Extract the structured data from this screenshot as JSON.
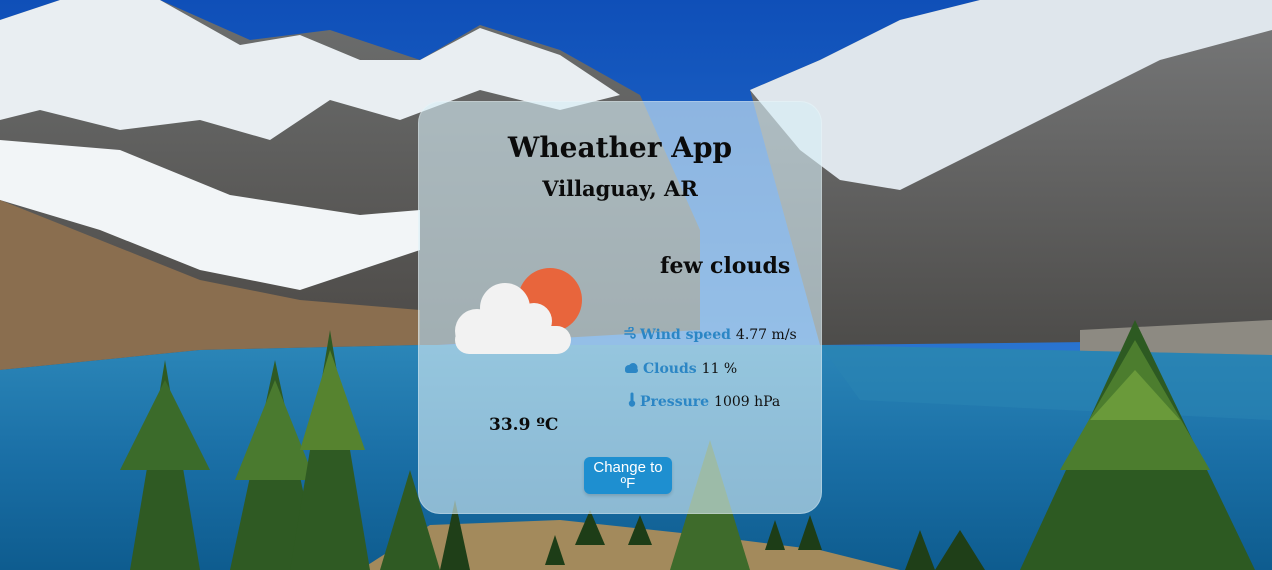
{
  "app": {
    "title": "Wheather App",
    "location": "Villaguay, AR"
  },
  "weather": {
    "description": "few clouds",
    "icon": "few-clouds-icon",
    "temperature": "33.9 ºC"
  },
  "stats": {
    "wind": {
      "icon": "wind-icon",
      "label": "Wind speed",
      "value": "4.77 m/s"
    },
    "clouds": {
      "icon": "cloud-icon",
      "label": "Clouds",
      "value": "11 %"
    },
    "pressure": {
      "icon": "thermometer-icon",
      "label": "Pressure",
      "value": "1009 hPa"
    }
  },
  "actions": {
    "toggle_unit_label": "Change to ºF"
  },
  "colors": {
    "accent": "#2b86c5",
    "button": "#1e8fd0",
    "sun": "#e8653c",
    "cloud": "#f2f2f2"
  }
}
